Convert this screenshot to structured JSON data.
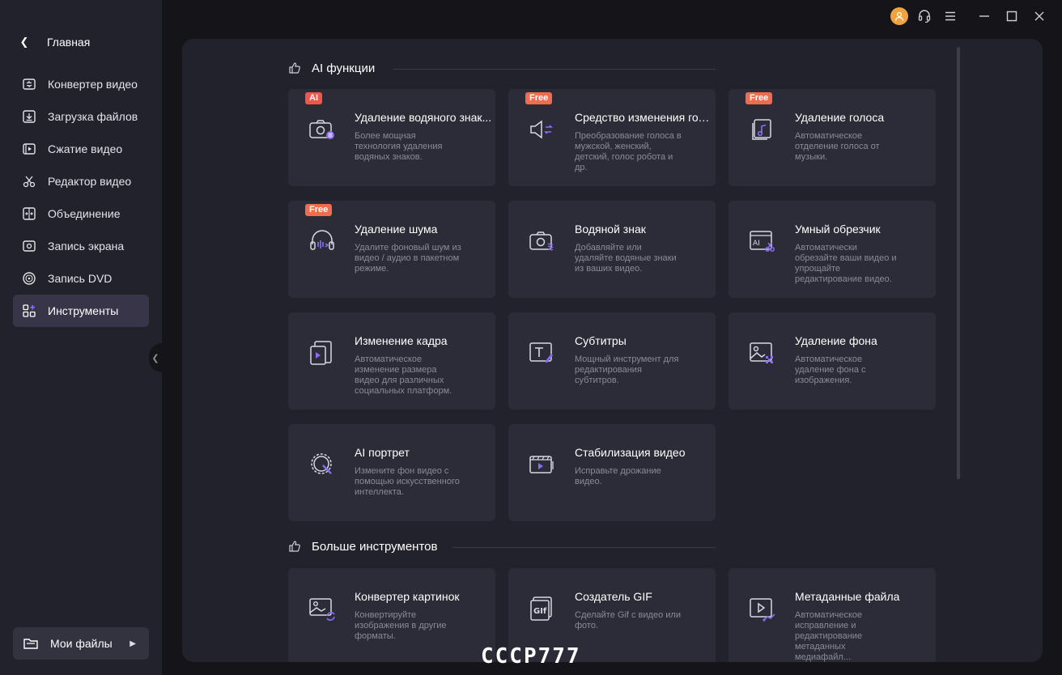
{
  "sidebar": {
    "home_label": "Главная",
    "items": [
      {
        "label": "Конвертер видео",
        "icon": "convert-icon"
      },
      {
        "label": "Загрузка файлов",
        "icon": "download-icon"
      },
      {
        "label": "Сжатие видео",
        "icon": "compress-icon"
      },
      {
        "label": "Редактор видео",
        "icon": "scissors-icon"
      },
      {
        "label": "Объединение",
        "icon": "merge-icon"
      },
      {
        "label": "Запись экрана",
        "icon": "screen-record-icon"
      },
      {
        "label": "Запись DVD",
        "icon": "dvd-icon"
      },
      {
        "label": "Инструменты",
        "icon": "tools-grid-icon",
        "active": true
      }
    ],
    "my_files_label": "Мои файлы"
  },
  "colors": {
    "accent": "#8b6cf0",
    "badge": "#f06c4f",
    "avatar": "#f0a33c"
  },
  "sections": {
    "ai_title": "AI функции",
    "more_title": "Больше инструментов"
  },
  "ai_cards": [
    {
      "badge": "AI",
      "title": "Удаление водяного знак...",
      "desc": "Более мощная технология удаления водяных знаков.",
      "icon": "watermark-remove-icon"
    },
    {
      "badge": "Free",
      "title": "Средство изменения гол...",
      "desc": "Преобразование голоса в мужской, женский, детский, голос робота и др.",
      "icon": "voice-changer-icon"
    },
    {
      "badge": "Free",
      "title": "Удаление голоса",
      "desc": "Автоматическое отделение голоса от музыки.",
      "icon": "vocal-remove-icon"
    },
    {
      "badge": "Free",
      "title": "Удаление шума",
      "desc": "Удалите фоновый шум из видео / аудио в пакетном режиме.",
      "icon": "noise-remove-icon"
    },
    {
      "badge": "",
      "title": "Водяной знак",
      "desc": "Добавляйте или удаляйте водяные знаки из ваших видео.",
      "icon": "watermark-icon"
    },
    {
      "badge": "",
      "title": "Умный обрезчик",
      "desc": "Автоматически обрезайте ваши видео и упрощайте редактирование видео.",
      "icon": "smart-trimmer-icon"
    },
    {
      "badge": "",
      "title": "Изменение кадра",
      "desc": "Автоматическое изменение размера видео для различных социальных платформ.",
      "icon": "reframe-icon"
    },
    {
      "badge": "",
      "title": "Субтитры",
      "desc": "Мощный инструмент для редактирования субтитров.",
      "icon": "subtitle-icon"
    },
    {
      "badge": "",
      "title": "Удаление фона",
      "desc": "Автоматическое удаление фона с изображения.",
      "icon": "background-remove-icon"
    },
    {
      "badge": "",
      "title": "AI портрет",
      "desc": "Измените фон видео с помощью искусственного интеллекта.",
      "icon": "ai-portrait-icon"
    },
    {
      "badge": "",
      "title": "Стабилизация видео",
      "desc": "Исправьте дрожание видео.",
      "icon": "stabilize-icon"
    }
  ],
  "more_cards": [
    {
      "title": "Конвертер картинок",
      "desc": "Конвертируйте изображения в другие форматы.",
      "icon": "image-convert-icon"
    },
    {
      "title": "Создатель GIF",
      "desc": "Сделайте Gif с видео или фото.",
      "icon": "gif-icon"
    },
    {
      "title": "Метаданные файла",
      "desc": "Автоматическое исправление и редактирование метаданных медиафайл...",
      "icon": "metadata-icon"
    }
  ],
  "watermark_text": "CCCP777"
}
